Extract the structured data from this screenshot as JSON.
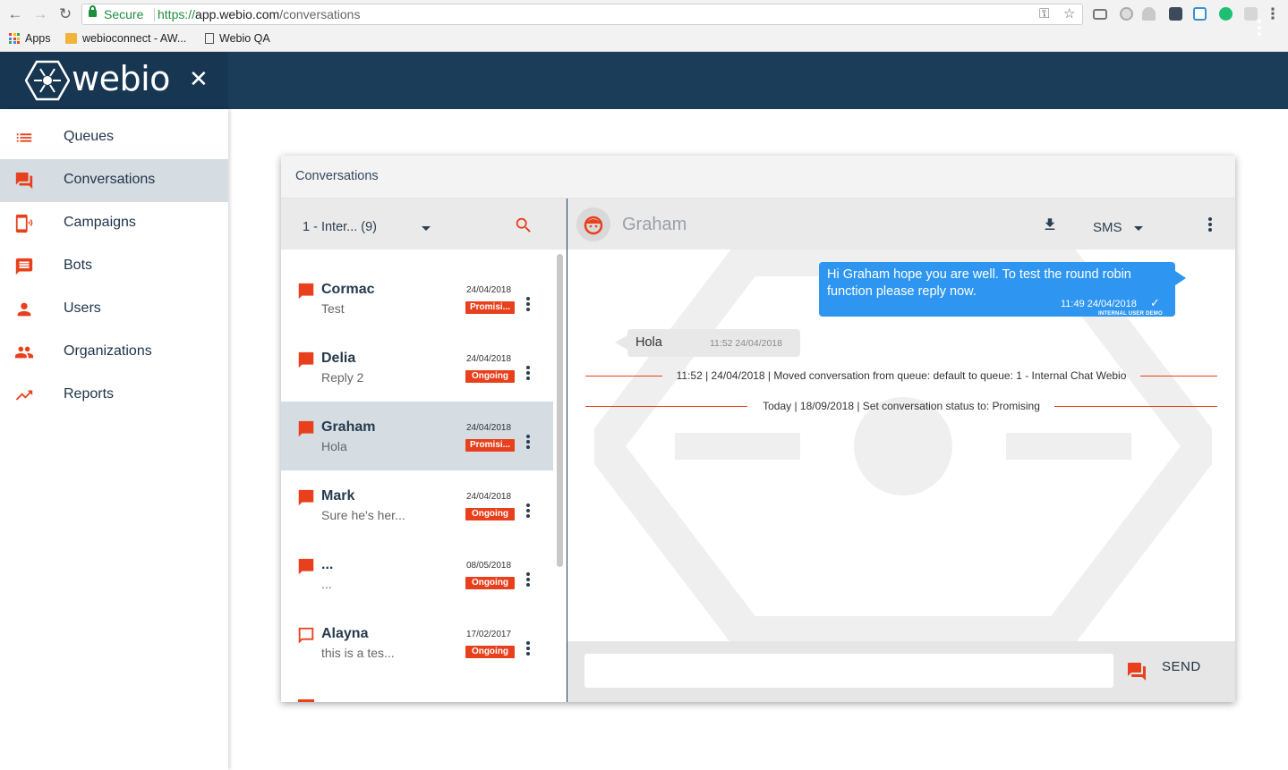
{
  "browser": {
    "secure_label": "Secure",
    "url_scheme": "https://",
    "url_host": "app.webio.com",
    "url_path": "/conversations",
    "bookmarks": [
      {
        "label": "Apps",
        "icon": "apps-grid-icon"
      },
      {
        "label": "webioconnect - AW...",
        "icon": "package-icon"
      },
      {
        "label": "Webio QA",
        "icon": "page-icon"
      }
    ]
  },
  "app": {
    "logo_text": "webio",
    "brand_color": "#1c3d5a",
    "accent_color": "#e8401c"
  },
  "sidebar": {
    "items": [
      {
        "label": "Queues",
        "icon": "list-icon"
      },
      {
        "label": "Conversations",
        "icon": "forum-icon",
        "active": true
      },
      {
        "label": "Campaigns",
        "icon": "phone-ring-icon"
      },
      {
        "label": "Bots",
        "icon": "message-text-icon"
      },
      {
        "label": "Users",
        "icon": "person-icon"
      },
      {
        "label": "Organizations",
        "icon": "people-icon"
      },
      {
        "label": "Reports",
        "icon": "trending-up-icon"
      }
    ]
  },
  "main": {
    "title": "Conversations",
    "queue_selector": "1 - Inter... (9)",
    "conversations": [
      {
        "name": "Cormac",
        "preview": "Test",
        "date": "24/04/2018",
        "status": "Promisi...",
        "flag": "filled"
      },
      {
        "name": "Delia",
        "preview": "Reply 2",
        "date": "24/04/2018",
        "status": "Ongoing",
        "flag": "filled"
      },
      {
        "name": "Graham",
        "preview": "Hola",
        "date": "24/04/2018",
        "status": "Promisi...",
        "flag": "filled",
        "active": true
      },
      {
        "name": "Mark",
        "preview": "Sure he's her...",
        "date": "24/04/2018",
        "status": "Ongoing",
        "flag": "filled"
      },
      {
        "name": "...",
        "preview": "...",
        "date": "08/05/2018",
        "status": "Ongoing",
        "flag": "filled"
      },
      {
        "name": "Alayna",
        "preview": "this is a tes...",
        "date": "17/02/2017",
        "status": "Ongoing",
        "flag": "outline"
      }
    ],
    "chat": {
      "contact_name": "Graham",
      "channel": "SMS",
      "messages": [
        {
          "direction": "out",
          "text": "Hi Graham hope you are well. To test the round robin function please reply now.",
          "time": "11:49 24/04/2018",
          "author": "INTERNAL USER DEMO"
        },
        {
          "direction": "in",
          "text": "Hola",
          "time": "11:52 24/04/2018"
        }
      ],
      "events": [
        {
          "text": "11:52 | 24/04/2018 | Moved conversation from queue: default to queue: 1 - Internal Chat Webio"
        },
        {
          "text": "Today | 18/09/2018 | Set conversation status to: Promising"
        }
      ],
      "composer_placeholder": "",
      "send_label": "SEND"
    }
  }
}
